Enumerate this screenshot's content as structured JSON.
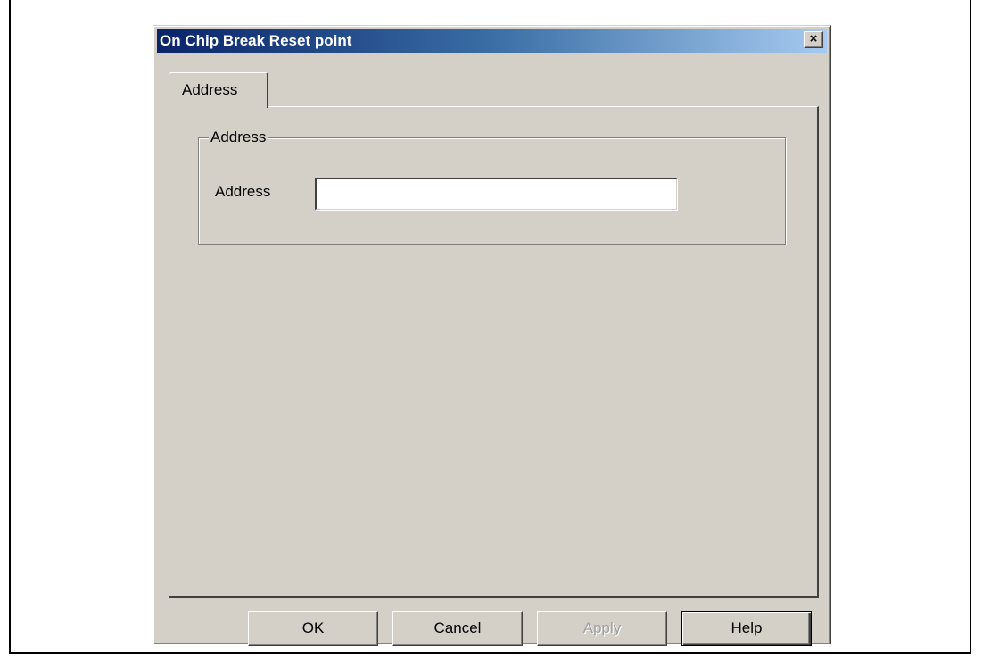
{
  "window": {
    "title": "On Chip Break Reset point",
    "close_label": "×"
  },
  "tabs": [
    {
      "label": "Address"
    }
  ],
  "group": {
    "legend": "Address",
    "field_label": "Address",
    "field_value": ""
  },
  "buttons": {
    "ok": "OK",
    "cancel": "Cancel",
    "apply": "Apply",
    "help": "Help"
  },
  "colors": {
    "titlebar_start": "#0a246a",
    "titlebar_end": "#a6caf0",
    "dialog_face": "#d4d0c8"
  }
}
